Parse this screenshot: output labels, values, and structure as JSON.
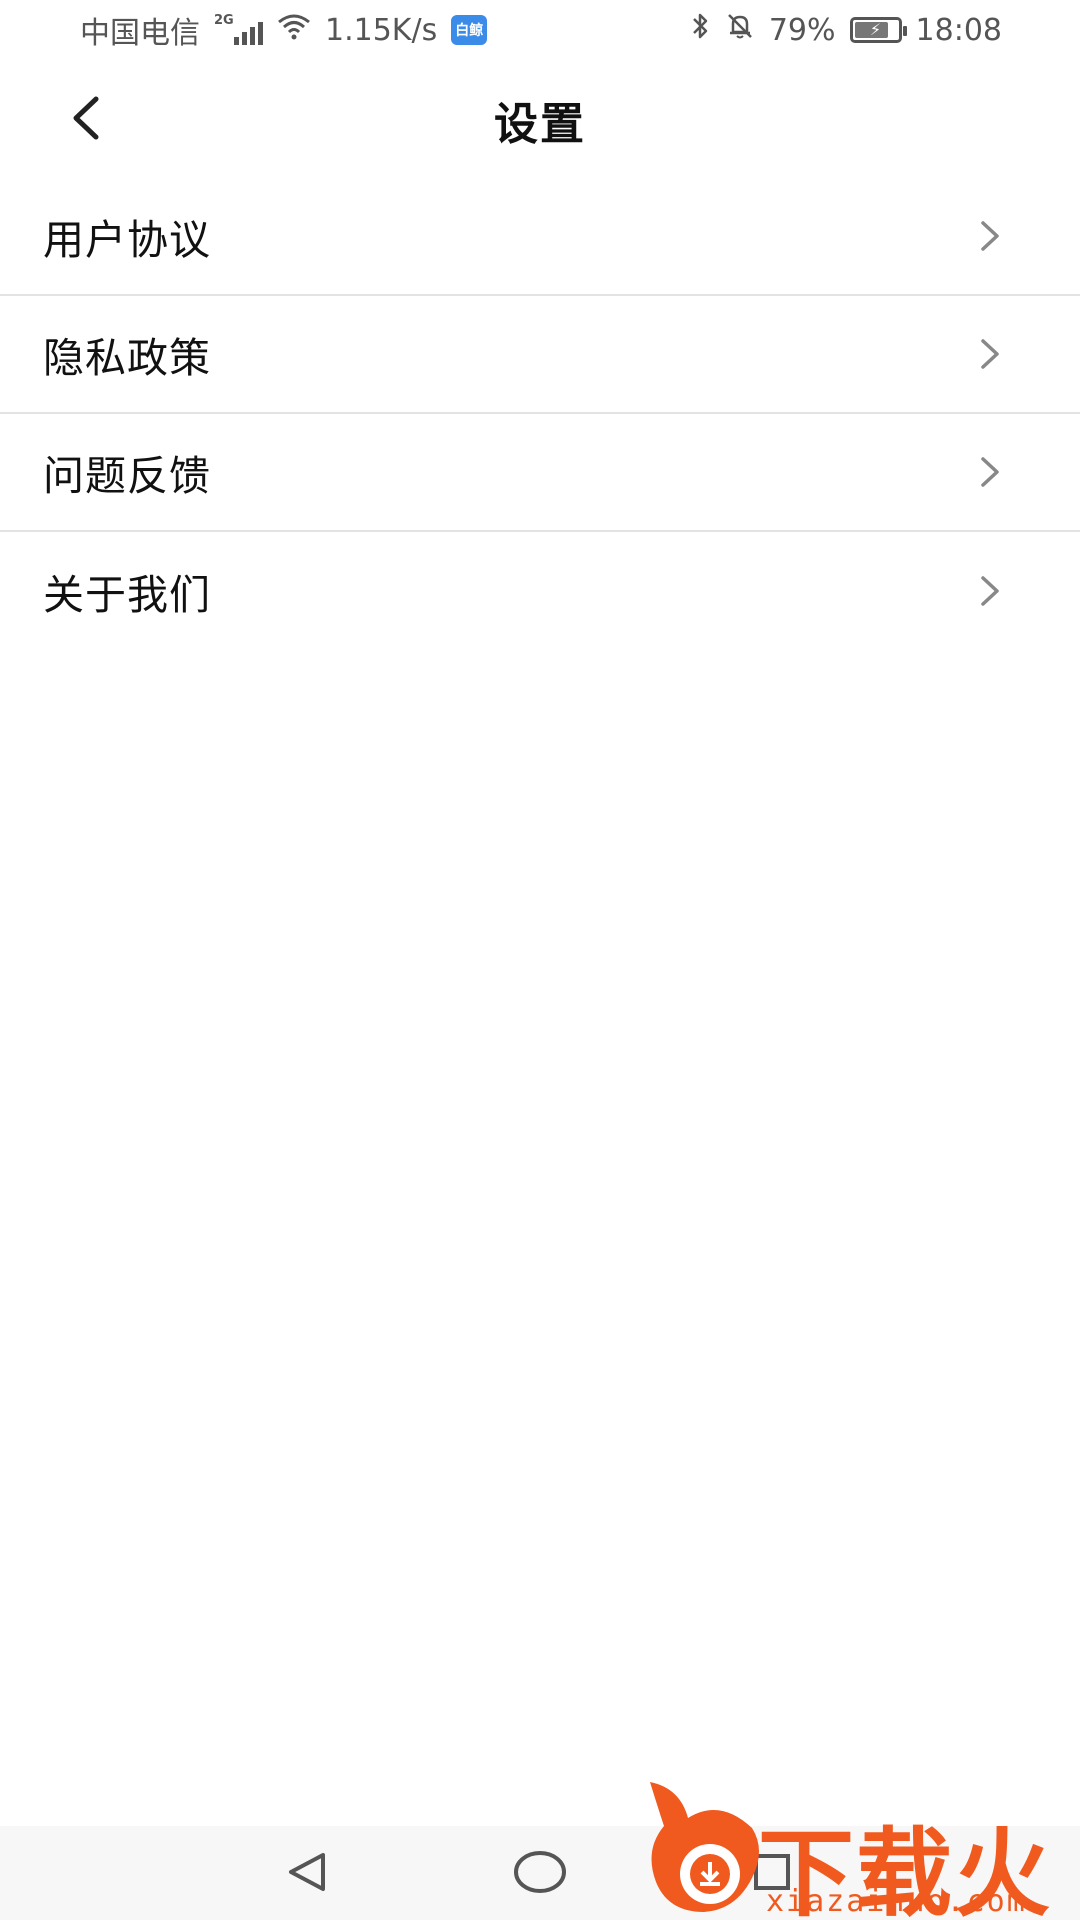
{
  "status_bar": {
    "carrier": "中国电信",
    "network_type": "2G",
    "speed": "1.15K/s",
    "app_badge": "白鲸",
    "battery_percent": "79%",
    "battery_level": 0.79,
    "time": "18:08",
    "icons": [
      "signal-icon",
      "wifi-icon",
      "app-badge-icon",
      "bluetooth-icon",
      "mute-bell-icon",
      "battery-icon"
    ]
  },
  "header": {
    "title": "设置",
    "back_icon": "chevron-left-icon"
  },
  "settings": {
    "items": [
      {
        "label": "用户协议",
        "icon": "chevron-right-icon"
      },
      {
        "label": "隐私政策",
        "icon": "chevron-right-icon"
      },
      {
        "label": "问题反馈",
        "icon": "chevron-right-icon"
      },
      {
        "label": "关于我们",
        "icon": "chevron-right-icon"
      }
    ]
  },
  "nav_bar": {
    "icons": [
      "back-triangle-icon",
      "home-circle-icon",
      "recent-square-icon"
    ]
  },
  "watermark": {
    "text": "下载火",
    "domain": "xiazaihuo.com"
  },
  "colors": {
    "divider": "#e3e3e3",
    "watermark": "#f05a1e",
    "status_text": "#555555"
  }
}
